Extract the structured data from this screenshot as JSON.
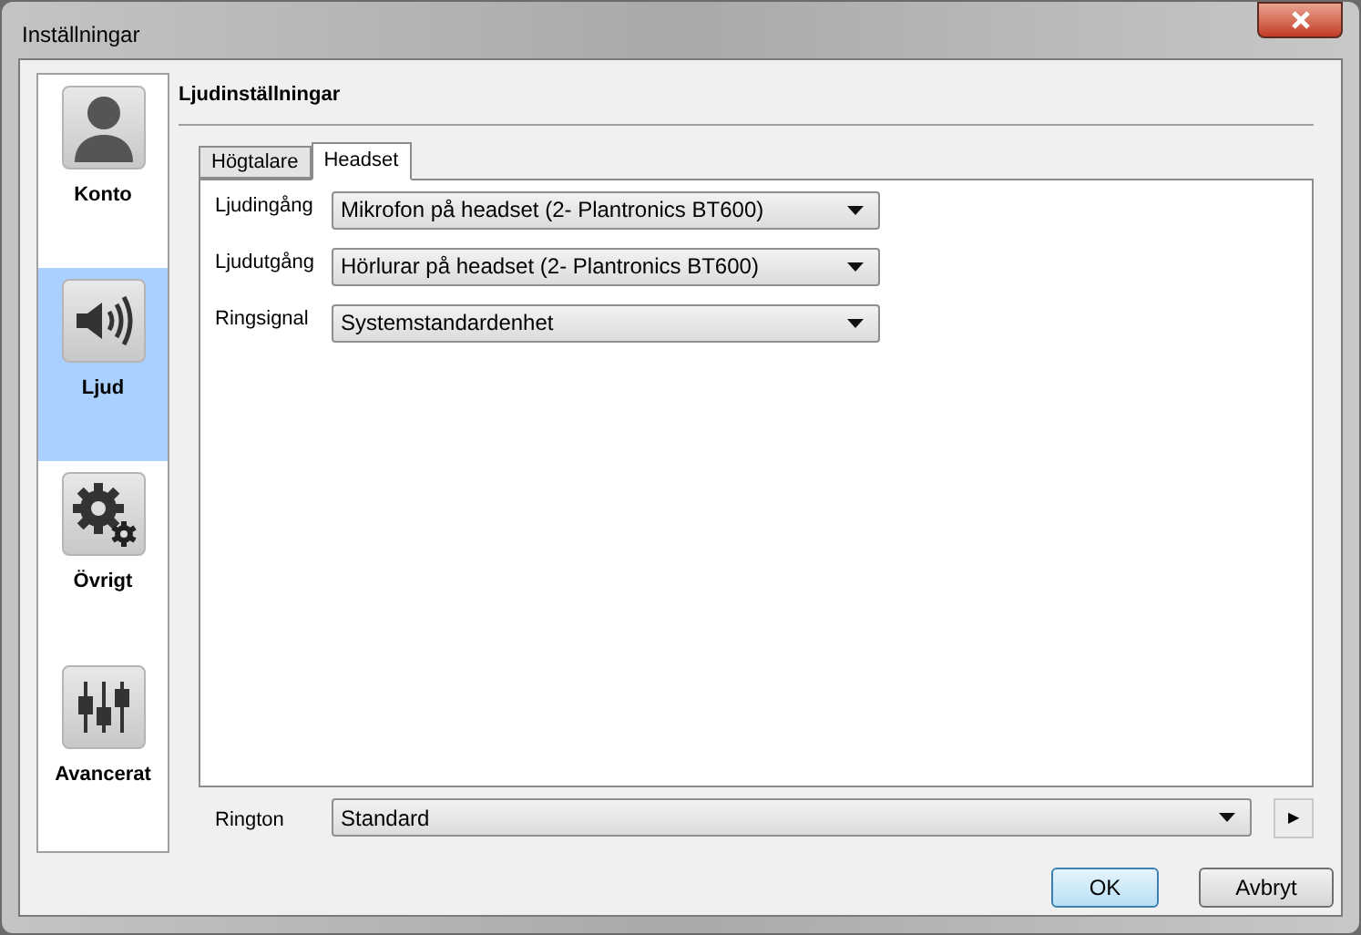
{
  "window": {
    "title": "Inställningar"
  },
  "sidebar": {
    "items": [
      {
        "kind": "account",
        "label": "Konto",
        "selected": false
      },
      {
        "kind": "sound",
        "label": "Ljud",
        "selected": true
      },
      {
        "kind": "other",
        "label": "Övrigt",
        "selected": false
      },
      {
        "kind": "advanced",
        "label": "Avancerat",
        "selected": false
      }
    ]
  },
  "heading": "Ljudinställningar",
  "tabs": [
    {
      "label": "Högtalare",
      "selected": false
    },
    {
      "label": "Headset",
      "selected": true
    }
  ],
  "fields": [
    {
      "label": "Ljudingång",
      "value": "Mikrofon på headset (2- Plantronics BT600)"
    },
    {
      "label": "Ljudutgång",
      "value": "Hörlurar på headset (2- Plantronics BT600)"
    },
    {
      "label": "Ringsignal",
      "value": "Systemstandardenhet"
    }
  ],
  "ringtone": {
    "label": "Rington",
    "value": "Standard",
    "play": "▶"
  },
  "buttons": [
    {
      "label": "OK",
      "default": true
    },
    {
      "label": "Avbryt",
      "default": false
    }
  ]
}
